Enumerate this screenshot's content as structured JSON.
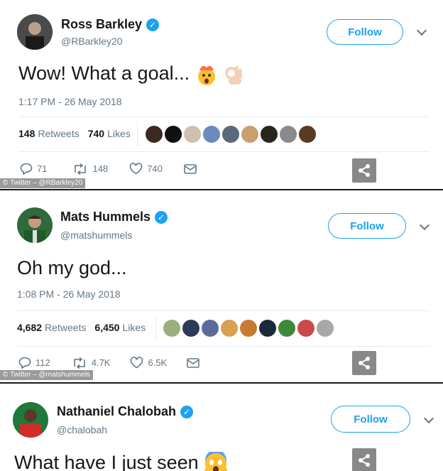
{
  "colors": {
    "accent": "#1da1f2",
    "muted": "#657786"
  },
  "tweets": [
    {
      "name": "Ross Barkley",
      "handle": "@RBarkley20",
      "follow_label": "Follow",
      "text": "Wow! What a goal...",
      "emojis": [
        "exploding-head-emoji",
        "ok-hand-emoji"
      ],
      "time": "1:17 PM - 26 May 2018",
      "retweets_count": "148",
      "retweets_label": "Retweets",
      "likes_count": "740",
      "likes_label": "Likes",
      "replies": "71",
      "rt_action": "148",
      "like_action": "740",
      "credit": "© Twitter – @RBarkley20",
      "face_colors": [
        "#3a2a22",
        "#111111",
        "#d0c0b0",
        "#6a8bbd",
        "#5a6a7a",
        "#c8a070",
        "#2a2520",
        "#8a8a8a",
        "#5a3a20"
      ]
    },
    {
      "name": "Mats Hummels",
      "handle": "@matshummels",
      "follow_label": "Follow",
      "text": "Oh my god...",
      "emojis": [],
      "time": "1:08 PM - 26 May 2018",
      "retweets_count": "4,682",
      "retweets_label": "Retweets",
      "likes_count": "6,450",
      "likes_label": "Likes",
      "replies": "112",
      "rt_action": "4.7K",
      "like_action": "6.5K",
      "credit": "© Twitter – @matshummels",
      "face_colors": [
        "#9ab07a",
        "#2a3a5a",
        "#5a6a9a",
        "#d8a050",
        "#c87a30",
        "#1a2a3a",
        "#3a8a3a",
        "#c84a4a",
        "#a8a8a8"
      ]
    },
    {
      "name": "Nathaniel Chalobah",
      "handle": "@chalobah",
      "follow_label": "Follow",
      "text": "What have I just seen",
      "emojis": [
        "screaming-face-emoji"
      ]
    }
  ]
}
